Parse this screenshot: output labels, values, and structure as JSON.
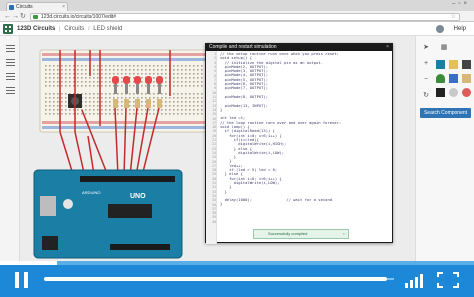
{
  "browser": {
    "tab_title": "Circuits",
    "url": "123d.circuits.io/circuits/1007/edit#"
  },
  "app": {
    "logo_text": "123D Circuits",
    "breadcrumb": [
      "Circuits",
      "LED shield"
    ],
    "help_label": "Help"
  },
  "code_panel": {
    "title": "Compile and restart simulation",
    "close_label": "×",
    "line_numbers": [
      "1",
      "2",
      "3",
      "4",
      "5",
      "6",
      "7",
      "8",
      "9",
      "10",
      "11",
      "12",
      "13",
      "14",
      "15",
      "16",
      "17",
      "18",
      "19",
      "20",
      "21",
      "22",
      "23",
      "24",
      "25",
      "26",
      "27",
      "28",
      "29",
      "30",
      "31",
      "32",
      "33",
      "34",
      "35",
      "36",
      "37",
      "38",
      "39",
      "40"
    ],
    "lines": [
      "// the setup routine runs once when you press reset:",
      "void setup() {",
      "  // initialize the digital pin as an output.",
      "  pinMode(2, OUTPUT);",
      "  pinMode(3, OUTPUT);",
      "  pinMode(4, OUTPUT);",
      "  pinMode(5, OUTPUT);",
      "  pinMode(6, OUTPUT);",
      "  pinMode(7, OUTPUT);",
      "",
      "  pinMode(8, OUTPUT);",
      "",
      "  pinMode(13, INPUT);",
      "}",
      "",
      "int led =1;",
      "// the loop routine runs over and over again forever:",
      "void loop() {",
      "  if (digitalRead(13)) {",
      "    for(int i=0; i<6;i++) {",
      "      if(i==led){",
      "        digitalWrite(i,HIGH);",
      "      } else {",
      "        digitalWrite(i,LOW);",
      "      }",
      "    }",
      "    led++;",
      "    if (led > 5) led = 0;",
      "  } else {",
      "    for(int i=0; i<6;i++) {",
      "      digitalWrite(i,LOW);",
      "    }",
      "  }",
      "",
      "  delay(1000);               // wait for a second",
      "}",
      "",
      "",
      "",
      ""
    ],
    "toast_text": "Successfully compiled",
    "toast_close": "×"
  },
  "right_panel": {
    "search_button": "Search Component"
  },
  "player": {
    "progress": 0.12,
    "seek_position": 0.98
  },
  "colors": {
    "player_blue": "#1e88d8",
    "arduino_teal": "#1b7fa5",
    "wire_red": "#c42a2a",
    "led_red": "#e54848",
    "accent_blue": "#2f74b5"
  }
}
